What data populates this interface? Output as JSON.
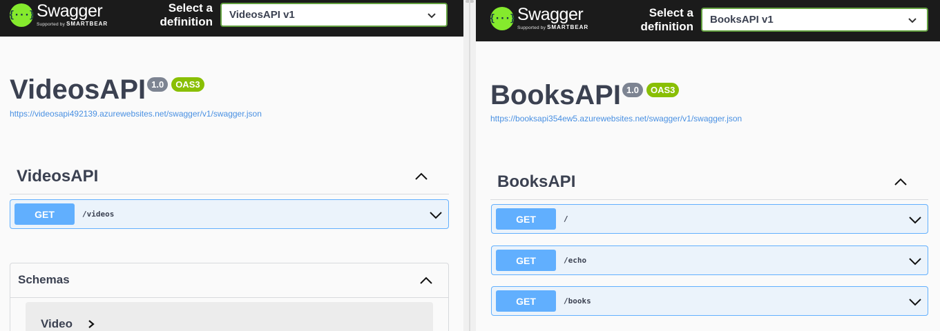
{
  "left": {
    "logo": {
      "name": "Swagger",
      "sub_prefix": "Supported by",
      "sub_brand": "SMARTBEAR",
      "glyph": "{···}"
    },
    "select_label_line1": "Select a",
    "select_label_line2": "definition",
    "definition": "VideosAPI v1",
    "title": "VideosAPI",
    "version": "1.0",
    "oas": "OAS3",
    "spec_url": "https://videosapi492139.azurewebsites.net/swagger/v1/swagger.json",
    "section": "VideosAPI",
    "operations": [
      {
        "method": "GET",
        "path": "/videos"
      }
    ],
    "schemas": {
      "title": "Schemas",
      "models": [
        "Video"
      ]
    }
  },
  "right": {
    "logo": {
      "name": "Swagger",
      "sub_prefix": "Supported by",
      "sub_brand": "SMARTBEAR",
      "glyph": "{···}"
    },
    "select_label_line1": "Select a",
    "select_label_line2": "definition",
    "definition": "BooksAPI v1",
    "title": "BooksAPI",
    "version": "1.0",
    "oas": "OAS3",
    "spec_url": "https://booksapi354ew5.azurewebsites.net/swagger/v1/swagger.json",
    "section": "BooksAPI",
    "operations": [
      {
        "method": "GET",
        "path": "/"
      },
      {
        "method": "GET",
        "path": "/echo"
      },
      {
        "method": "GET",
        "path": "/books"
      }
    ]
  },
  "colors": {
    "brand_green": "#85ea2d",
    "get_blue": "#61affe",
    "get_bg": "#ebf3fb",
    "oas_green": "#89bf04",
    "version_gray": "#7d8492",
    "topbar": "#1b1b1b"
  },
  "icons": {
    "logo": "swagger-logo-icon",
    "select": "chevron-down-icon",
    "section_toggle": "chevron-up-icon",
    "op_expand": "chevron-down-icon",
    "model_expand": "chevron-right-icon"
  }
}
